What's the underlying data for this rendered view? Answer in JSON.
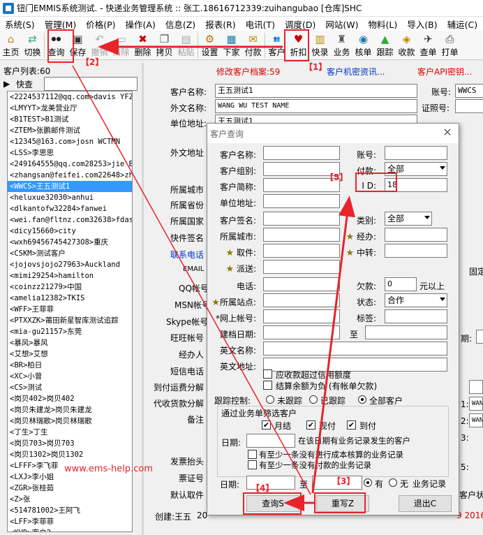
{
  "window": {
    "title": "钮门EMMIS系统测试. - 快递业务管理系统 :: 张工.18616712339:zuihangubao [仓库]SHC"
  },
  "menu": [
    "系统(S)",
    "管理(M)",
    "价格(P)",
    "操作(A)",
    "信息(Z)",
    "报表(R)",
    "电讯(T)",
    "调度(D)",
    "网站(W)",
    "物料(L)",
    "导入(B)",
    "辅运(C)",
    "代派"
  ],
  "toolbar": [
    {
      "label": "主页",
      "icon": "home-icon",
      "glyph": "⌂",
      "color": "#d08020"
    },
    {
      "label": "切换",
      "icon": "switch-icon",
      "glyph": "⇄",
      "color": "#3a7"
    },
    {
      "label": "查询",
      "icon": "binoculars-icon",
      "glyph": "●●",
      "color": "#222"
    },
    {
      "label": "保存",
      "icon": "save-icon",
      "glyph": "▣",
      "color": "#333"
    },
    {
      "label": "撤销",
      "icon": "undo-icon",
      "glyph": "↶",
      "color": "#aaa",
      "disabled": true
    },
    {
      "label": "清除",
      "icon": "clear-icon",
      "glyph": "▭",
      "color": "#aaa",
      "disabled": true
    },
    {
      "label": "删除",
      "icon": "delete-icon",
      "glyph": "✖",
      "color": "#c00"
    },
    {
      "label": "拷贝",
      "icon": "copy-icon",
      "glyph": "❐",
      "color": "#555"
    },
    {
      "label": "粘贴",
      "icon": "paste-icon",
      "glyph": "▤",
      "color": "#aaa",
      "disabled": true
    },
    {
      "label": "设置",
      "icon": "settings-icon",
      "glyph": "⚙",
      "color": "#c60"
    },
    {
      "label": "下家",
      "icon": "downstream-icon",
      "glyph": "▦",
      "color": "#27a"
    },
    {
      "label": "付款",
      "icon": "payment-icon",
      "glyph": "✉",
      "color": "#b80"
    },
    {
      "label": "客户",
      "icon": "customers-icon",
      "glyph": "👥",
      "color": "#27a"
    },
    {
      "label": "折扣",
      "icon": "discount-icon",
      "glyph": "♥",
      "color": "#c00"
    },
    {
      "label": "快录",
      "icon": "quick-entry-icon",
      "glyph": "▥",
      "color": "#b80"
    },
    {
      "label": "业务",
      "icon": "business-icon",
      "glyph": "♜",
      "color": "#555"
    },
    {
      "label": "核单",
      "icon": "verify-icon",
      "glyph": "◉",
      "color": "#27a"
    },
    {
      "label": "跟踪",
      "icon": "track-icon",
      "glyph": "▲",
      "color": "#3a3"
    },
    {
      "label": "收款",
      "icon": "collect-icon",
      "glyph": "◈",
      "color": "#b80"
    },
    {
      "label": "查单",
      "icon": "query-order-icon",
      "glyph": "✈",
      "color": "#333"
    },
    {
      "label": "打单",
      "icon": "print-icon",
      "glyph": "⎙",
      "color": "#333"
    }
  ],
  "left": {
    "count_label": "客户列表:60",
    "search_label": "快查",
    "customers": [
      "<2224537112@qq.com>davis YFZZ",
      "<LMYYT>龙美营业厅",
      "<B1TEST>B1测试",
      "<ZTEM>张鹏邮件测试",
      "<12345@163.com>josn WCTMN",
      "<LSS>李思思",
      "<249164555@qq.com28253>jie BM",
      "<zhangsan@feifei.com22648>zha",
      "<WWCS>王五测试1",
      "<heluxue32030>anhui",
      "<dlkantofw32284>fanwei",
      "<wei.fan@fltnz.com32638>fdas",
      "<dicy15660>city",
      "<wxh694567454273O8>重庆",
      "<CSKM>测试客户",
      "<jojovsjojo27963>Auckland",
      "<mimi29254>hamilton",
      "<coinzz21279>中国",
      "<amelia12382>TKIS",
      "<WFF>王菲菲",
      "<PTXXZK>莆田新星智库测试追踪",
      "<mia-gu21157>东莞",
      "<暴风>暴风",
      "<艾想>艾想",
      "<BR>柏日",
      "<XC>小曾",
      "<CS>测试",
      "<岗贝402>岗贝402",
      "<岗贝朱建龙>岗贝朱建龙",
      "<岗贝林瑞歌>岗贝林瑞歌",
      "<丁生>丁生",
      "<岗贝703>岗贝703",
      "<岗贝1302>岗贝1302",
      "<LFFF>李飞菲",
      "<LXJ>李小姐",
      "<ZGR>张桂茹",
      "<Z>张",
      "<514781002>王阿飞",
      "<LFF>李菲菲",
      "<KHD>客户2"
    ],
    "selected_index": 8
  },
  "main": {
    "tabs": [
      "修改客户档案:59",
      "客户机密资讯...",
      "客户API密钥..."
    ],
    "name_label": "客户名称:",
    "name_value": "王五测试1",
    "account_label": "账号:",
    "account_value": "WWCS",
    "foreign_name_label": "外文名称:",
    "foreign_name_value": "WANG WU TEST NAME",
    "id_no_label": "证照号:",
    "address_label": "单位地址:",
    "address_value": "王五测试1",
    "foreign_addr_label": "外文地址",
    "city_label": "所属城市",
    "province_label": "所属省份",
    "country_label": "所属国家",
    "sign_label": "快件签名",
    "contact_label": "联系电话",
    "email_label": "EMAIL",
    "qq_label": "QQ帐号",
    "msn_label": "MSN帐号",
    "skype_label": "Skype帐号",
    "wangwang_label": "旺旺帐号",
    "manager_label": "经办人",
    "sms_label": "短信电话",
    "prepay_label": "到付运费分解",
    "cod_label": "代收货款分解",
    "note_label": "备注",
    "invoice_label": "发票抬头",
    "voucher_label": "票证号",
    "default_label": "默认取件",
    "fixed_label": "固定",
    "date_label": "期:",
    "cust_api_label": "客户状",
    "right_vals": [
      "WAN",
      "WAN"
    ],
    "right_nums": [
      "1:",
      "2:",
      "3:",
      "5:"
    ],
    "created_label": "创建:王五",
    "created_value": "20",
    "created_right": "9 2016"
  },
  "dialog": {
    "title": "客户查询",
    "fields": {
      "cust_name": "客户名称:",
      "account": "账号:",
      "cust_group": "客户组别:",
      "pay": "付款:",
      "pay_value": "全部",
      "short_name": "客户简称:",
      "id": "I D:",
      "id_value": "18",
      "unit_addr": "单位地址:",
      "cust_sign": "客户签名:",
      "category": "类别:",
      "category_value": "全部",
      "city": "所属城市:",
      "handler": "经办:",
      "pickup": "取件:",
      "transfer": "中转:",
      "dispatch": "派送:",
      "phone": "电话:",
      "owed": "欠款:",
      "owed_value": "0",
      "owed_unit": "元以上",
      "station": "所属站点:",
      "status": "状态:",
      "status_value": "合作",
      "web_account": "*网上帐号:",
      "tag": "标签:",
      "build_date": "建档日期:",
      "to": "至",
      "foreign_name": "英文名称:",
      "foreign_addr": "英文地址:"
    },
    "checks": {
      "overdue": "应收款超过信用额度",
      "negative": "结算余额为负 (有帐单欠款)"
    },
    "tracking": {
      "label": "跟踪控制:",
      "options": [
        "未跟踪",
        "已跟踪",
        "全部客户"
      ],
      "selected": 2
    },
    "group": {
      "title": "通过业务单筛选客户",
      "checks": [
        "月结",
        "现付",
        "到付"
      ],
      "date_label": "日期:",
      "date_hint": "在该日期有业务记录发生的客户",
      "opt1": "有至少一条没有进行成本核算的业务记录",
      "opt2": "有至少一条没有付款的业务记录",
      "date2_label": "日期:",
      "to": "至",
      "yes": "有",
      "no": "无",
      "records": "业务记录",
      "rec_selected": "yes"
    },
    "buttons": {
      "query": "查询S",
      "reset": "重写Z",
      "exit": "退出C"
    }
  },
  "annotations": {
    "labels": [
      "【1】",
      "【2】",
      "【3】",
      "【4】",
      "【5】"
    ],
    "color": "#e8232a",
    "watermark": "www.ems-help.com"
  }
}
